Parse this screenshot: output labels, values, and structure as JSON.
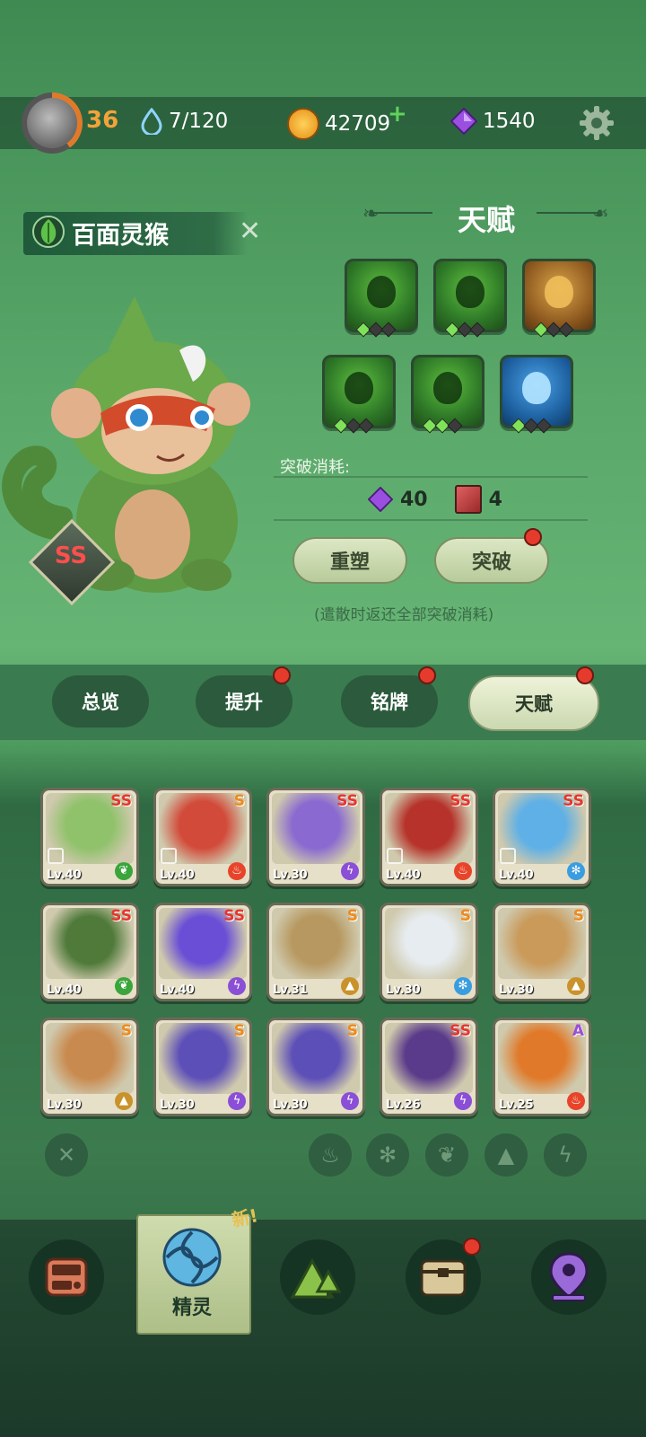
{
  "header": {
    "level": "36",
    "energy": "7/120",
    "coins": "42709",
    "gems": "1540"
  },
  "pet": {
    "name": "百面灵猴",
    "rank": "SS"
  },
  "talent": {
    "title": "天赋",
    "cost_label": "突破消耗:",
    "cost_gems": "40",
    "cost_books": "4",
    "reshape_label": "重塑",
    "breakthrough_label": "突破",
    "hint": "(遣散时返还全部突破消耗)",
    "slots": [
      {
        "icon": "claw-icon",
        "color": "green",
        "level": 1
      },
      {
        "icon": "drop-shape-icon",
        "color": "green",
        "level": 1
      },
      {
        "icon": "gold-bowl-icon",
        "color": "gold",
        "level": 1
      },
      {
        "icon": "spiky-seed-icon",
        "color": "green",
        "level": 1
      },
      {
        "icon": "spiky-seed-icon",
        "color": "green",
        "level": 2
      },
      {
        "icon": "eye-icon",
        "color": "blue",
        "level": 1
      }
    ]
  },
  "tabs": [
    {
      "label": "总览",
      "active": false,
      "badge": false
    },
    {
      "label": "提升",
      "active": false,
      "badge": true
    },
    {
      "label": "铭牌",
      "active": false,
      "badge": true
    },
    {
      "label": "天赋",
      "active": true,
      "badge": true
    }
  ],
  "roster": [
    {
      "lv": "Lv.40",
      "rank": "SS",
      "element": "leaf",
      "locked": true,
      "art": "#8fc26a"
    },
    {
      "lv": "Lv.40",
      "rank": "S",
      "element": "fire",
      "locked": true,
      "art": "#d24b3a"
    },
    {
      "lv": "Lv.30",
      "rank": "SS",
      "element": "thunder",
      "locked": false,
      "art": "#8a6ad0"
    },
    {
      "lv": "Lv.40",
      "rank": "SS",
      "element": "fire",
      "locked": true,
      "art": "#b6322a"
    },
    {
      "lv": "Lv.40",
      "rank": "SS",
      "element": "ice",
      "locked": true,
      "art": "#5fb0e6"
    },
    {
      "lv": "Lv.40",
      "rank": "SS",
      "element": "leaf",
      "locked": false,
      "art": "#4f7a3a"
    },
    {
      "lv": "Lv.40",
      "rank": "SS",
      "element": "thunder",
      "locked": false,
      "art": "#6a4fd6"
    },
    {
      "lv": "Lv.31",
      "rank": "S",
      "element": "earth",
      "locked": false,
      "art": "#b79860"
    },
    {
      "lv": "Lv.30",
      "rank": "S",
      "element": "ice",
      "locked": false,
      "art": "#e6ecef"
    },
    {
      "lv": "Lv.30",
      "rank": "S",
      "element": "earth",
      "locked": false,
      "art": "#c99a5a"
    },
    {
      "lv": "Lv.30",
      "rank": "S",
      "element": "earth",
      "locked": false,
      "art": "#c98a4f"
    },
    {
      "lv": "Lv.30",
      "rank": "S",
      "element": "thunder",
      "locked": false,
      "art": "#5d4fb8"
    },
    {
      "lv": "Lv.30",
      "rank": "S",
      "element": "thunder",
      "locked": false,
      "art": "#5d4fb8"
    },
    {
      "lv": "Lv.26",
      "rank": "SS",
      "element": "thunder",
      "locked": false,
      "art": "#5a3a8a"
    },
    {
      "lv": "Lv.25",
      "rank": "A",
      "element": "fire",
      "locked": false,
      "art": "#e07a2a"
    }
  ],
  "element_colors": {
    "leaf": "#3aa53a",
    "fire": "#e8442a",
    "thunder": "#8a4fd6",
    "ice": "#3a9de0",
    "earth": "#c9922a"
  },
  "filters": [
    "close-filter-icon",
    "fire-filter-icon",
    "ice-filter-icon",
    "leaf-filter-icon",
    "earth-filter-icon",
    "thunder-filter-icon"
  ],
  "nav": {
    "active_label": "精灵",
    "new_tag": "新!"
  }
}
